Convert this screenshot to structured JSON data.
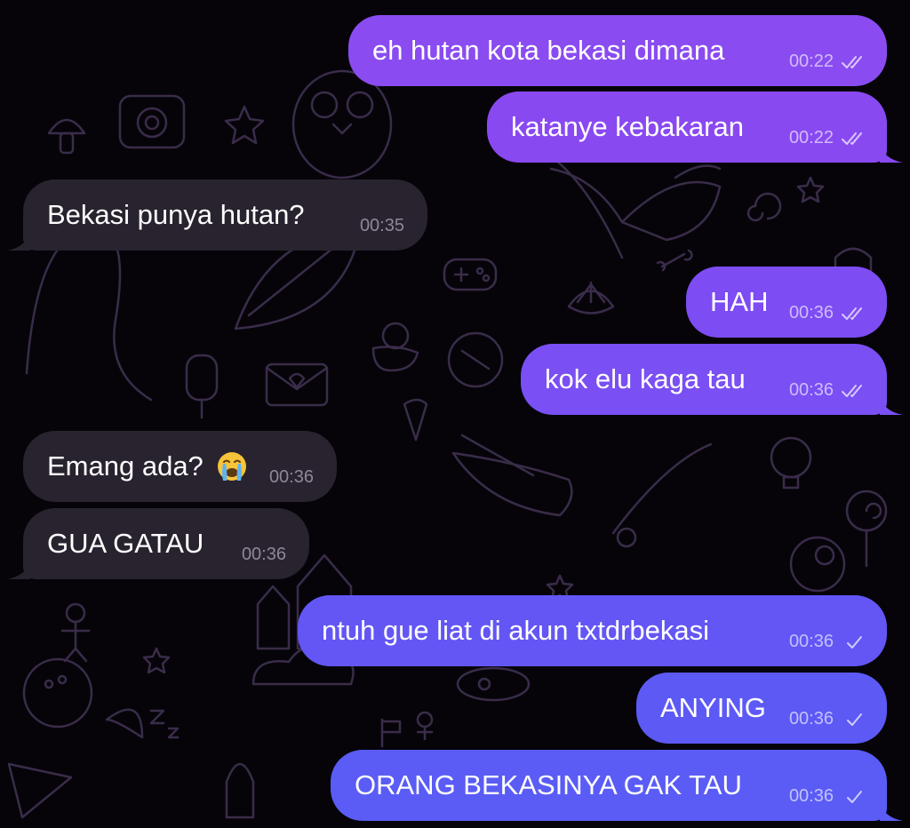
{
  "colors": {
    "background": "#060409",
    "doodle": "#3a2c4a",
    "incoming_bubble": "#29232f",
    "outgoing_purple": "#8a4cf0",
    "outgoing_blue": "#5a5af5"
  },
  "messages": [
    {
      "id": "m1",
      "direction": "outgoing",
      "text": "eh hutan kota bekasi dimana",
      "time": "00:22",
      "status": "read",
      "color": "#8a4cf0"
    },
    {
      "id": "m2",
      "direction": "outgoing",
      "text": "katanye kebakaran",
      "time": "00:22",
      "status": "read",
      "color": "#8949f1"
    },
    {
      "id": "m3",
      "direction": "incoming",
      "text": "Bekasi punya hutan?",
      "time": "00:35"
    },
    {
      "id": "m4",
      "direction": "outgoing",
      "text": "HAH",
      "time": "00:36",
      "status": "read",
      "color": "#7d4cf3"
    },
    {
      "id": "m5",
      "direction": "outgoing",
      "text": "kok elu kaga tau",
      "time": "00:36",
      "status": "read",
      "color": "#7a4ff3"
    },
    {
      "id": "m6",
      "direction": "incoming",
      "text": "Emang ada?",
      "emoji": "loudly-crying-face-icon",
      "time": "00:36"
    },
    {
      "id": "m7",
      "direction": "incoming",
      "text": "GUA GATAU",
      "time": "00:36"
    },
    {
      "id": "m8",
      "direction": "outgoing",
      "text": "ntuh gue liat di akun txtdrbekasi",
      "time": "00:36",
      "status": "delivered",
      "color": "#6356f4"
    },
    {
      "id": "m9",
      "direction": "outgoing",
      "text": "ANYING",
      "time": "00:36",
      "status": "delivered",
      "color": "#5d59f5"
    },
    {
      "id": "m10",
      "direction": "outgoing",
      "text": "ORANG BEKASINYA GAK TAU",
      "time": "00:36",
      "status": "delivered",
      "color": "#5a5cf5"
    }
  ]
}
